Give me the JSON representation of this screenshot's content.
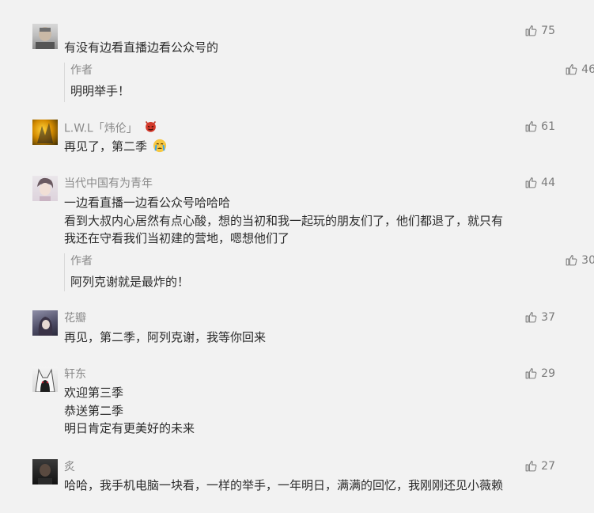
{
  "comments": [
    {
      "nickname": "",
      "likes": "75",
      "lines": [
        "有没有边看直播边看公众号的"
      ],
      "reply": {
        "nickname": "作者",
        "text": "明明举手！",
        "likes": "46"
      }
    },
    {
      "nickname": "L.W.L「炜伦」",
      "badge_icon": "devil-emoji",
      "likes": "61",
      "lines": [
        "再见了，第二季"
      ],
      "line_emoji": "crying-face-emoji"
    },
    {
      "nickname": "当代中国有为青年",
      "likes": "44",
      "lines": [
        "一边看直播一边看公众号哈哈哈",
        "看到大叔内心居然有点心酸，想的当初和我一起玩的朋友们了，他们都退了，就只有",
        "我还在守看我们当初建的营地，嗯想他们了"
      ],
      "reply": {
        "nickname": "作者",
        "text": "阿列克谢就是最炸的！",
        "likes": "30"
      }
    },
    {
      "nickname": "花瓣",
      "likes": "37",
      "lines": [
        "再见，第二季，阿列克谢，我等你回来"
      ]
    },
    {
      "nickname": "轩东",
      "likes": "29",
      "lines": [
        "欢迎第三季",
        "恭送第二季",
        "明日肯定有更美好的未来"
      ]
    },
    {
      "nickname": "炙",
      "likes": "27",
      "lines": [
        "哈哈，我手机电脑一块看，一样的举手，一年明日，满满的回忆，我刚刚还见小薇赖"
      ]
    }
  ],
  "colors": {
    "background": "#f2f2f2",
    "text": "#2b2b2b",
    "secondary": "#8a8a8a",
    "like": "#7b7b7b"
  }
}
